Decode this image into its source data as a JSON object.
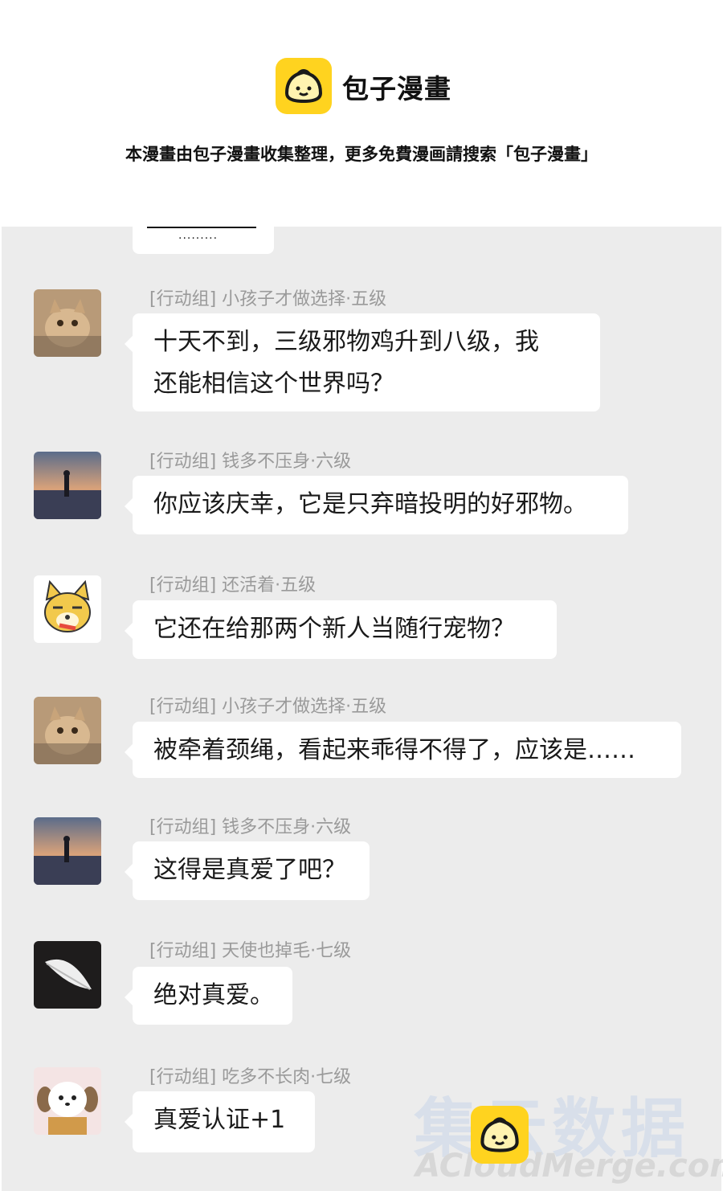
{
  "header": {
    "brand_name": "包子漫畫",
    "notice": "本漫畫由包子漫畫收集整理，更多免費漫画請搜索「包子漫畫」"
  },
  "previous_message": {
    "text": "........."
  },
  "messages": [
    {
      "sender": "[行动组] 小孩子才做选择·五级",
      "avatar": "cat-avatar",
      "lines": [
        "十天不到，三级邪物鸡升到八级，我",
        "还能相信这个世界吗？"
      ]
    },
    {
      "sender": "[行动组] 钱多不压身·六级",
      "avatar": "sunset-silhouette-avatar",
      "lines": [
        "你应该庆幸，它是只弃暗投明的好邪物。"
      ]
    },
    {
      "sender": "[行动组] 还活着·五级",
      "avatar": "doge-avatar",
      "lines": [
        "它还在给那两个新人当随行宠物？"
      ]
    },
    {
      "sender": "[行动组] 小孩子才做选择·五级",
      "avatar": "cat-avatar",
      "lines": [
        "被牵着颈绳，看起来乖得不得了，应该是……"
      ]
    },
    {
      "sender": "[行动组] 钱多不压身·六级",
      "avatar": "sunset-silhouette-avatar",
      "lines": [
        "这得是真爱了吧？"
      ]
    },
    {
      "sender": "[行动组] 天使也掉毛·七级",
      "avatar": "feather-avatar",
      "lines": [
        "绝对真爱。"
      ]
    },
    {
      "sender": "[行动组] 吃多不长肉·七级",
      "avatar": "puppy-cake-avatar",
      "lines": [
        "真爱认证+1"
      ]
    }
  ],
  "watermark": {
    "main": "集云数据",
    "sub": "ACloudMerge.com"
  },
  "colors": {
    "brand_yellow": "#ffd31f",
    "chat_bg": "#ececec",
    "bubble_bg": "#ffffff",
    "name_gray": "#9a9a9a"
  }
}
